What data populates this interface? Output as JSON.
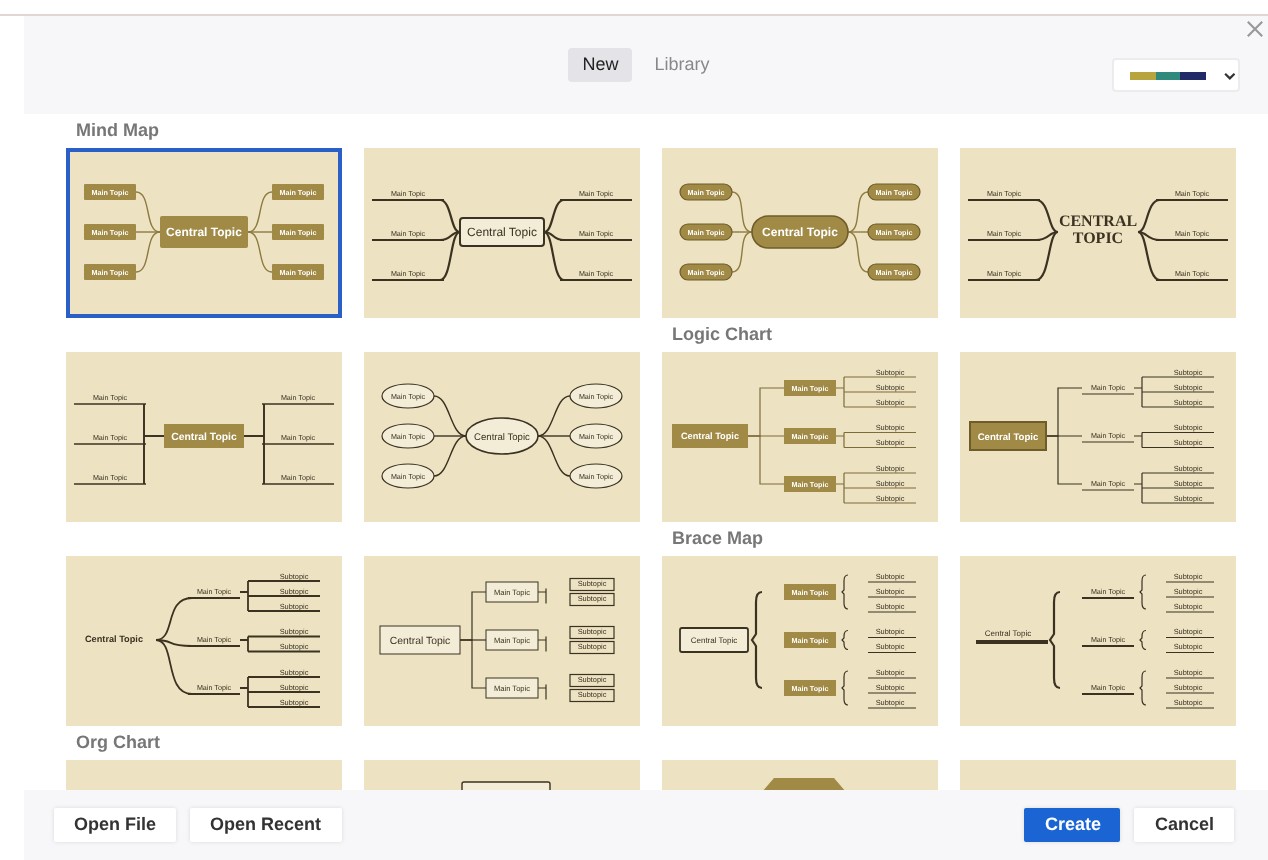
{
  "tabs": [
    {
      "label": "New",
      "selected": true
    },
    {
      "label": "Library",
      "selected": false
    }
  ],
  "theme": {
    "swatches": [
      {
        "color": "#b8a43c"
      },
      {
        "color": "#2f8a7c"
      },
      {
        "color": "#1f2a66"
      }
    ]
  },
  "sections": [
    {
      "title": "Mind Map",
      "templates": [
        {
          "kind": "mind-filled",
          "selected": true,
          "central": "Central Topic",
          "topics": [
            {
              "label": "Main Topic"
            },
            {
              "label": "Main Topic"
            },
            {
              "label": "Main Topic"
            },
            {
              "label": "Main Topic"
            },
            {
              "label": "Main Topic"
            },
            {
              "label": "Main Topic"
            }
          ]
        },
        {
          "kind": "mind-underline",
          "selected": false,
          "central": "Central Topic",
          "topics": [
            {
              "label": "Main Topic"
            },
            {
              "label": "Main Topic"
            },
            {
              "label": "Main Topic"
            },
            {
              "label": "Main Topic"
            },
            {
              "label": "Main Topic"
            },
            {
              "label": "Main Topic"
            }
          ]
        },
        {
          "kind": "mind-pill",
          "selected": false,
          "central": "Central Topic",
          "topics": [
            {
              "label": "Main Topic"
            },
            {
              "label": "Main Topic"
            },
            {
              "label": "Main Topic"
            },
            {
              "label": "Main Topic"
            },
            {
              "label": "Main Topic"
            },
            {
              "label": "Main Topic"
            }
          ]
        },
        {
          "kind": "mind-caps",
          "selected": false,
          "central": "CENTRAL TOPIC",
          "topics": [
            {
              "label": "Main Topic"
            },
            {
              "label": "Main Topic"
            },
            {
              "label": "Main Topic"
            },
            {
              "label": "Main Topic"
            },
            {
              "label": "Main Topic"
            },
            {
              "label": "Main Topic"
            }
          ]
        },
        {
          "kind": "mind-lines",
          "selected": false,
          "central": "Central Topic",
          "topics": [
            {
              "label": "Main Topic"
            },
            {
              "label": "Main Topic"
            },
            {
              "label": "Main Topic"
            },
            {
              "label": "Main Topic"
            },
            {
              "label": "Main Topic"
            },
            {
              "label": "Main Topic"
            }
          ]
        },
        {
          "kind": "mind-ellipse",
          "selected": false,
          "central": "Central Topic",
          "topics": [
            {
              "label": "Main Topic"
            },
            {
              "label": "Main Topic"
            },
            {
              "label": "Main Topic"
            },
            {
              "label": "Main Topic"
            },
            {
              "label": "Main Topic"
            },
            {
              "label": "Main Topic"
            }
          ]
        }
      ]
    },
    {
      "title": "Logic Chart",
      "templates": [
        {
          "kind": "logic-filled",
          "selected": false,
          "central": "Central Topic",
          "topics": [
            {
              "label": "Main Topic",
              "subtopics": [
                "Subtopic",
                "Subtopic",
                "Subtopic"
              ]
            },
            {
              "label": "Main Topic",
              "subtopics": [
                "Subtopic",
                "Subtopic"
              ]
            },
            {
              "label": "Main Topic",
              "subtopics": [
                "Subtopic",
                "Subtopic",
                "Subtopic"
              ]
            }
          ]
        },
        {
          "kind": "logic-outline",
          "selected": false,
          "central": "Central Topic",
          "topics": [
            {
              "label": "Main Topic",
              "subtopics": [
                "Subtopic",
                "Subtopic",
                "Subtopic"
              ]
            },
            {
              "label": "Main Topic",
              "subtopics": [
                "Subtopic",
                "Subtopic"
              ]
            },
            {
              "label": "Main Topic",
              "subtopics": [
                "Subtopic",
                "Subtopic",
                "Subtopic"
              ]
            }
          ]
        },
        {
          "kind": "logic-curve",
          "selected": false,
          "central": "Central Topic",
          "topics": [
            {
              "label": "Main Topic",
              "subtopics": [
                "Subtopic",
                "Subtopic",
                "Subtopic"
              ]
            },
            {
              "label": "Main Topic",
              "subtopics": [
                "Subtopic",
                "Subtopic"
              ]
            },
            {
              "label": "Main Topic",
              "subtopics": [
                "Subtopic",
                "Subtopic",
                "Subtopic"
              ]
            }
          ]
        },
        {
          "kind": "logic-box",
          "selected": false,
          "central": "Central Topic",
          "topics": [
            {
              "label": "Main Topic",
              "subtopics": [
                "Subtopic",
                "Subtopic"
              ]
            },
            {
              "label": "Main Topic",
              "subtopics": [
                "Subtopic",
                "Subtopic"
              ]
            },
            {
              "label": "Main Topic",
              "subtopics": [
                "Subtopic",
                "Subtopic"
              ]
            }
          ]
        }
      ]
    },
    {
      "title": "Brace Map",
      "templates": [
        {
          "kind": "brace-filled",
          "selected": false,
          "central": "Central Topic",
          "topics": [
            {
              "label": "Main Topic",
              "subtopics": [
                "Subtopic",
                "Subtopic",
                "Subtopic"
              ]
            },
            {
              "label": "Main Topic",
              "subtopics": [
                "Subtopic",
                "Subtopic"
              ]
            },
            {
              "label": "Main Topic",
              "subtopics": [
                "Subtopic",
                "Subtopic",
                "Subtopic"
              ]
            }
          ]
        },
        {
          "kind": "brace-line",
          "selected": false,
          "central": "Central Topic",
          "topics": [
            {
              "label": "Main Topic",
              "subtopics": [
                "Subtopic",
                "Subtopic",
                "Subtopic"
              ]
            },
            {
              "label": "Main Topic",
              "subtopics": [
                "Subtopic",
                "Subtopic"
              ]
            },
            {
              "label": "Main Topic",
              "subtopics": [
                "Subtopic",
                "Subtopic",
                "Subtopic"
              ]
            }
          ]
        }
      ]
    },
    {
      "title": "Org Chart",
      "templates": [
        {
          "kind": "org-plain",
          "selected": false
        },
        {
          "kind": "org-box",
          "selected": false
        },
        {
          "kind": "org-filled",
          "selected": false
        },
        {
          "kind": "org-plain",
          "selected": false
        }
      ]
    }
  ],
  "footer": {
    "buttons": [
      {
        "label": "Open File",
        "primary": false
      },
      {
        "label": "Open Recent",
        "primary": false
      },
      {
        "label": "Create",
        "primary": true
      },
      {
        "label": "Cancel",
        "primary": false
      }
    ]
  }
}
